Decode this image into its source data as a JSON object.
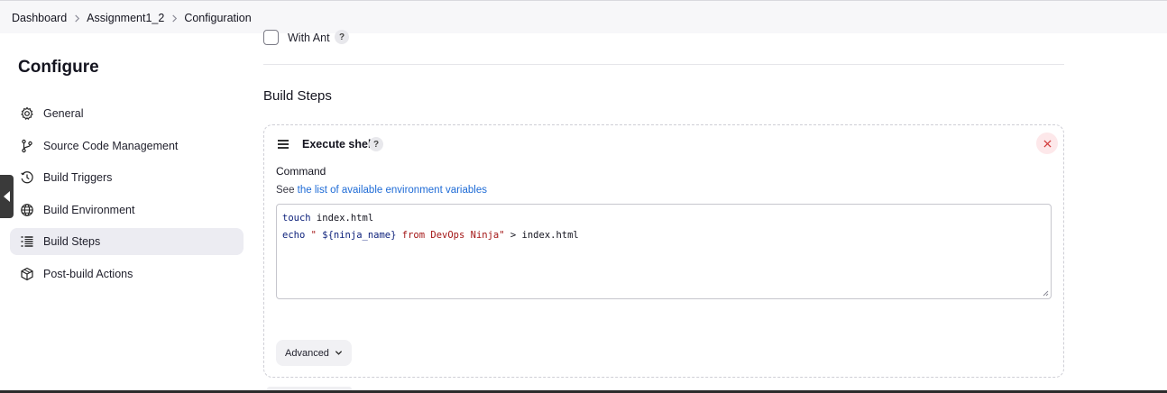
{
  "breadcrumb": {
    "items": [
      "Dashboard",
      "Assignment1_2",
      "Configuration"
    ]
  },
  "sidebar": {
    "title": "Configure",
    "items": [
      {
        "label": "General",
        "icon": "gear-icon"
      },
      {
        "label": "Source Code Management",
        "icon": "branch-icon"
      },
      {
        "label": "Build Triggers",
        "icon": "clock-icon"
      },
      {
        "label": "Build Environment",
        "icon": "globe-icon"
      },
      {
        "label": "Build Steps",
        "icon": "list-icon",
        "active": true
      },
      {
        "label": "Post-build Actions",
        "icon": "cube-icon"
      }
    ]
  },
  "main": {
    "with_ant": {
      "label": "With Ant",
      "checked": false,
      "help": "?"
    },
    "build_steps": {
      "title": "Build Steps",
      "step": {
        "title": "Execute shell",
        "help": "?",
        "command_label": "Command",
        "env_prefix": "See",
        "env_link": "the list of available environment variables",
        "code": {
          "line1_cmd": "touch",
          "line1_rest": " index.html",
          "line2_cmd": "echo",
          "line2_str_open": " \" ",
          "line2_var": "${ninja_name}",
          "line2_str_rest": " from DevOps Ninja\"",
          "line2_rest": " > index.html"
        },
        "advanced_label": "Advanced"
      }
    }
  },
  "colors": {
    "accent_link": "#1e6bd6",
    "delete_bg": "#fde8ea",
    "delete_icon": "#d33a3a",
    "active_item_bg": "#ececf2"
  }
}
